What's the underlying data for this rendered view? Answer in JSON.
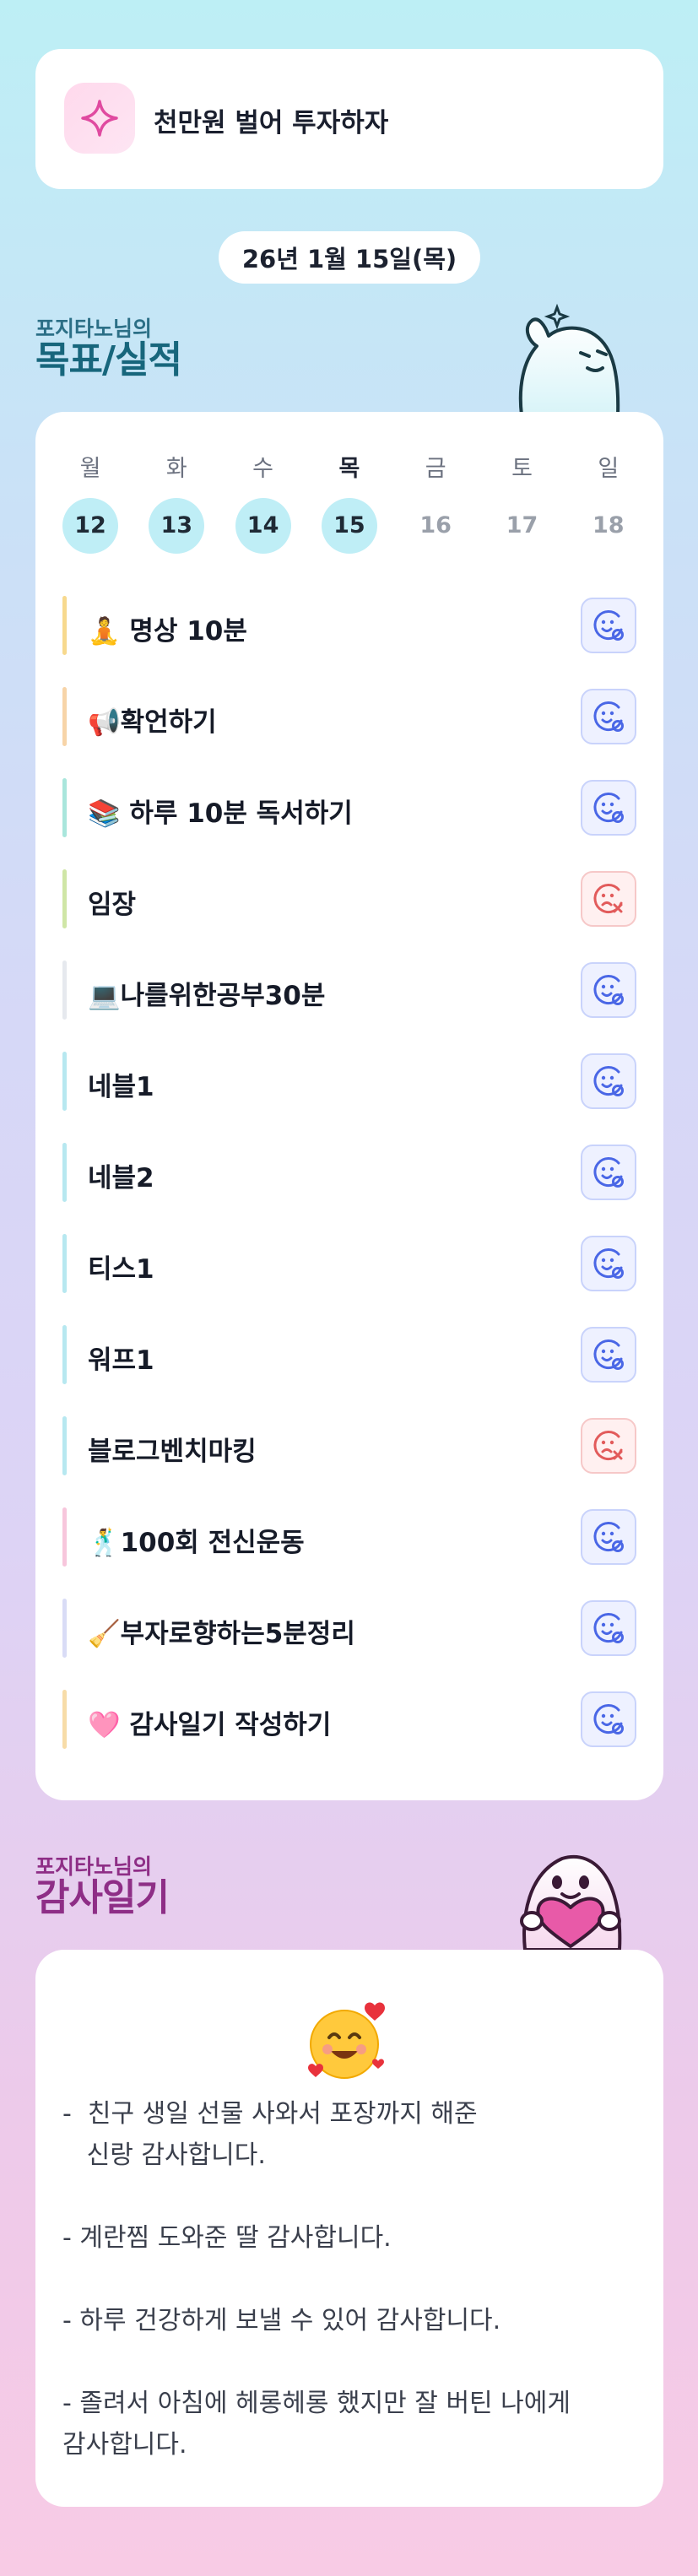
{
  "goal": {
    "text": "천만원 벌어 투자하자",
    "icon": "sparkle-icon"
  },
  "date": "26년 1월 15일(목)",
  "goals_section": {
    "small": "포지타노님의",
    "big": "목표/실적"
  },
  "week": [
    {
      "name": "월",
      "date": "12",
      "done": true
    },
    {
      "name": "화",
      "date": "13",
      "done": true
    },
    {
      "name": "수",
      "date": "14",
      "done": true
    },
    {
      "name": "목",
      "date": "15",
      "done": true,
      "today": true
    },
    {
      "name": "금",
      "date": "16",
      "done": false
    },
    {
      "name": "토",
      "date": "17",
      "done": false
    },
    {
      "name": "일",
      "date": "18",
      "done": false
    }
  ],
  "tasks": [
    {
      "label": "🧘 명상 10분",
      "status": "done",
      "color": "#f7d98e"
    },
    {
      "label": "📢확언하기",
      "status": "done",
      "color": "#f7d4a8"
    },
    {
      "label": "📚 하루 10분 독서하기",
      "status": "done",
      "color": "#a9e6dc"
    },
    {
      "label": "임장",
      "status": "fail",
      "color": "#cfe6a6"
    },
    {
      "label": "💻나를위한공부30분",
      "status": "done",
      "color": "#e6e9ee"
    },
    {
      "label": "네블1",
      "status": "done",
      "color": "#b7e8f0"
    },
    {
      "label": "네블2",
      "status": "done",
      "color": "#b7e8f0"
    },
    {
      "label": "티스1",
      "status": "done",
      "color": "#b7e8f0"
    },
    {
      "label": "워프1",
      "status": "done",
      "color": "#b7e8f0"
    },
    {
      "label": "블로그벤치마킹",
      "status": "fail",
      "color": "#b7e8f0"
    },
    {
      "label": "🕺100회 전신운동",
      "status": "done",
      "color": "#f7c6dc"
    },
    {
      "label": "🧹부자로향하는5분정리",
      "status": "done",
      "color": "#d9dcf6"
    },
    {
      "label": "🩷 감사일기 작성하기",
      "status": "done",
      "color": "#f7dca8"
    }
  ],
  "gratitude_section": {
    "small": "포지타노님의",
    "big": "감사일기"
  },
  "gratitude": {
    "emoji": "smiling-face-with-hearts-icon",
    "entries": [
      "-  친구 생일 선물 사와서 포장까지 해준\n   신랑 감사합니다.",
      "- 계란찜 도와준 딸 감사합니다.",
      "- 하루 건강하게 보낼 수 있어 감사합니다.",
      "- 졸려서 아침에 헤롱헤롱 했지만 잘 버틴 나에게\n감사합니다."
    ]
  },
  "colors": {
    "ok": "#4a67e6",
    "fail": "#e25b5b",
    "accent_teal": "#17667c",
    "accent_purple": "#8e2e86"
  }
}
